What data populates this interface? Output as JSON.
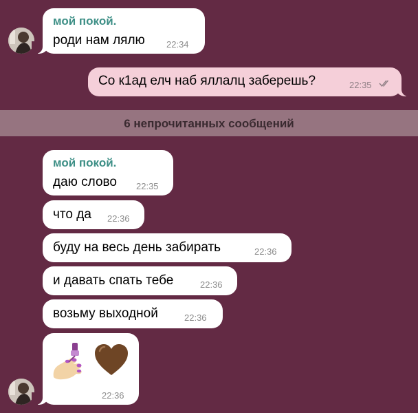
{
  "messages_top": {
    "sender": "мой покой.",
    "text": "роди нам лялю",
    "time": "22:34"
  },
  "outgoing": {
    "text": "Со к1ад елч наб яллалц заберешь?",
    "time": "22:35",
    "status_icon": "double-check-read-icon"
  },
  "unread_banner": {
    "label": "6 непрочитанных сообщений"
  },
  "group": {
    "sender": "мой покой.",
    "messages": [
      {
        "text": "даю слово",
        "time": "22:35"
      },
      {
        "text": "что да",
        "time": "22:36"
      },
      {
        "text": "буду на весь день забирать",
        "time": "22:36"
      },
      {
        "text": "и давать спать тебе",
        "time": "22:36"
      },
      {
        "text": "возьму выходной",
        "time": "22:36"
      }
    ],
    "emoji_message": {
      "emojis": [
        "nail-polish-emoji",
        "brown-heart-emoji"
      ],
      "time": "22:36"
    }
  },
  "colors": {
    "background": "#632a44",
    "incoming_bubble": "#ffffff",
    "outgoing_bubble": "#f5cfd9",
    "sender_name": "#3d8f86",
    "banner": "#967480"
  }
}
